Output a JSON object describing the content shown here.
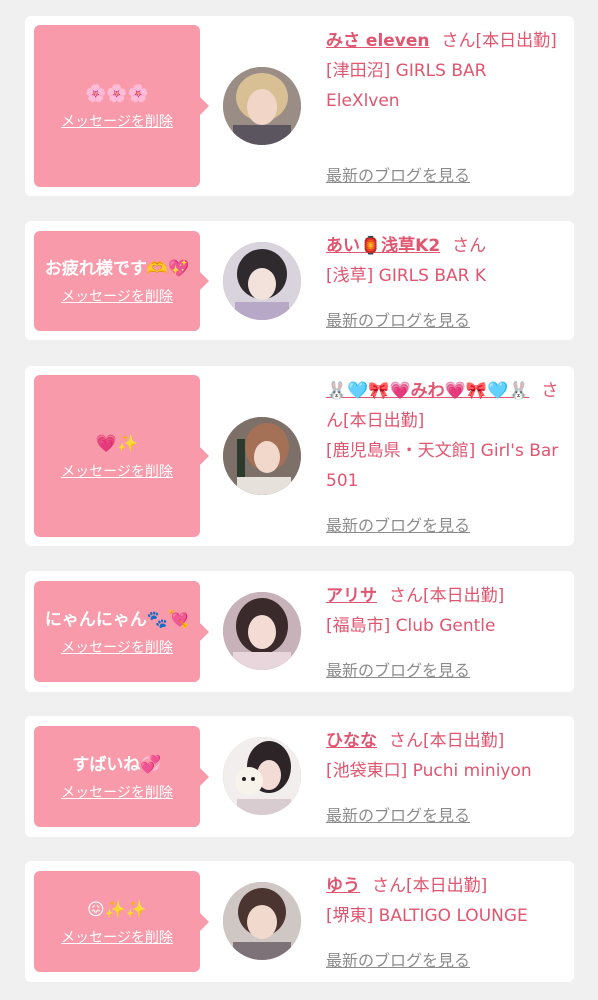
{
  "delete_label": "メッセージを削除",
  "blog_label": "最新のブログを見る",
  "san_label": "さん",
  "items": [
    {
      "message": "🌸🌸🌸",
      "name": "みさ eleven",
      "status": "[本日出勤]",
      "shop": "[津田沼] GIRLS BAR EleXlven"
    },
    {
      "message": "お疲れ様です🫶💖",
      "name": "あい🏮浅草K2",
      "status": "",
      "shop": "[浅草] GIRLS BAR K"
    },
    {
      "message": "💗✨",
      "name": "🐰🩵🎀💗みわ💗🎀🩵🐰",
      "status": "[本日出勤]",
      "shop": "[鹿児島県・天文館] Girl's Bar 501"
    },
    {
      "message": "にゃんにゃん🐾💘",
      "name": "アリサ",
      "status": "[本日出勤]",
      "shop": "[福島市] Club Gentle"
    },
    {
      "message": "すばいね💞",
      "name": "ひなな",
      "status": "[本日出勤]",
      "shop": "[池袋東口] Puchi miniyon"
    },
    {
      "message": "😖✨✨",
      "name": "ゆう",
      "status": "[本日出勤]",
      "shop": "[堺東] BALTIGO LOUNGE"
    }
  ],
  "colors": {
    "bubble": "#f99aaa",
    "accent": "#e0556f",
    "blog": "#8c8c8c"
  }
}
